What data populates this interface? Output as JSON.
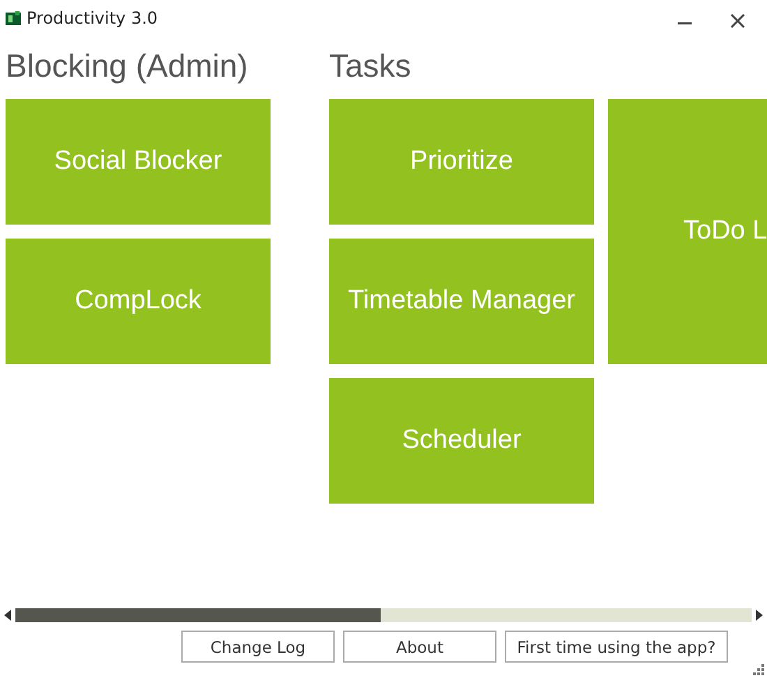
{
  "window": {
    "title": "Productivity 3.0"
  },
  "groups": [
    {
      "title": "Blocking (Admin)",
      "columns": [
        [
          {
            "label": "Social Blocker",
            "kind": "square"
          },
          {
            "label": "CompLock",
            "kind": "square"
          }
        ]
      ]
    },
    {
      "title": "Tasks",
      "columns": [
        [
          {
            "label": "Prioritize",
            "kind": "square"
          },
          {
            "label": "Timetable Manager",
            "kind": "square"
          },
          {
            "label": "Scheduler",
            "kind": "square"
          }
        ],
        [
          {
            "label": "ToDo L",
            "kind": "tall"
          }
        ]
      ]
    }
  ],
  "buttons": [
    "Change Log",
    "About",
    "First time using the app?"
  ]
}
